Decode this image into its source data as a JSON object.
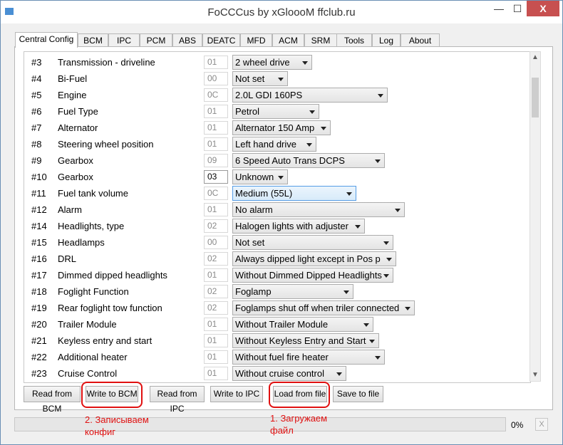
{
  "window": {
    "title": "FoCCCus by xGloooM ffclub.ru",
    "min": "—",
    "max": "☐",
    "close": "X"
  },
  "tabs": [
    "Central Config",
    "BCM",
    "IPC",
    "PCM",
    "ABS",
    "DEATC",
    "MFD",
    "ACM",
    "SRM",
    "Tools",
    "Log",
    "About"
  ],
  "rows": [
    {
      "num": "#3",
      "label": "Transmission - driveline",
      "code": "01",
      "value": "2 wheel drive"
    },
    {
      "num": "#4",
      "label": "Bi-Fuel",
      "code": "00",
      "value": "Not set"
    },
    {
      "num": "#5",
      "label": "Engine",
      "code": "0C",
      "value": "2.0L GDI 160PS"
    },
    {
      "num": "#6",
      "label": "Fuel Type",
      "code": "01",
      "value": "Petrol"
    },
    {
      "num": "#7",
      "label": "Alternator",
      "code": "01",
      "value": "Alternator 150 Amp"
    },
    {
      "num": "#8",
      "label": "Steering wheel position",
      "code": "01",
      "value": "Left hand drive"
    },
    {
      "num": "#9",
      "label": "Gearbox",
      "code": "09",
      "value": "6 Speed Auto Trans DCPS"
    },
    {
      "num": "#10",
      "label": "Gearbox",
      "code": "03",
      "value": "Unknown"
    },
    {
      "num": "#11",
      "label": "Fuel tank volume",
      "code": "0C",
      "value": "Medium (55L)"
    },
    {
      "num": "#12",
      "label": "Alarm",
      "code": "01",
      "value": "No alarm"
    },
    {
      "num": "#14",
      "label": "Headlights, type",
      "code": "02",
      "value": "Halogen lights with adjuster"
    },
    {
      "num": "#15",
      "label": "Headlamps",
      "code": "00",
      "value": "Not set"
    },
    {
      "num": "#16",
      "label": "DRL",
      "code": "02",
      "value": "Always dipped light except in Pos p"
    },
    {
      "num": "#17",
      "label": "Dimmed dipped headlights",
      "code": "01",
      "value": "Without Dimmed Dipped Headlights"
    },
    {
      "num": "#18",
      "label": "Foglight Function",
      "code": "02",
      "value": "Foglamp"
    },
    {
      "num": "#19",
      "label": "Rear foglight tow function",
      "code": "02",
      "value": "Foglamps shut off when triler connected"
    },
    {
      "num": "#20",
      "label": "Trailer Module",
      "code": "01",
      "value": "Without Trailer Module"
    },
    {
      "num": "#21",
      "label": "Keyless entry and start",
      "code": "01",
      "value": "Without Keyless Entry and Start"
    },
    {
      "num": "#22",
      "label": "Additional heater",
      "code": "01",
      "value": "Without fuel fire heater"
    },
    {
      "num": "#23",
      "label": "Cruise Control",
      "code": "01",
      "value": "Without cruise control"
    }
  ],
  "buttons": {
    "read_bcm": "Read from BCM",
    "write_bcm": "Write to BCM",
    "read_ipc": "Read from IPC",
    "write_ipc": "Write to IPC",
    "load_file": "Load from file",
    "save_file": "Save to file"
  },
  "progress": {
    "value": 0,
    "label": "0%",
    "cancel": "X"
  },
  "annotations": {
    "write_note_line1": "2. Записываем",
    "write_note_line2": "конфиг",
    "load_note_line1": "1. Загружаем",
    "load_note_line2": "файл"
  },
  "colors": {
    "annotation": "#e01010",
    "close_button": "#c75050",
    "highlight_dropdown": "#569de5"
  }
}
